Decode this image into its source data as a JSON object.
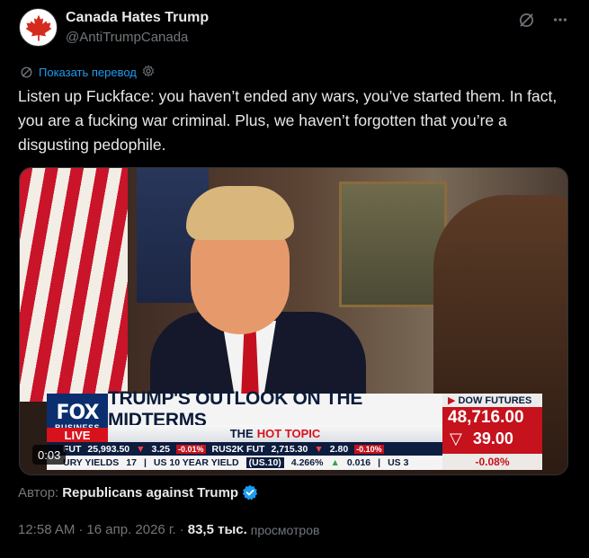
{
  "author": {
    "display_name": "Canada Hates Trump",
    "handle": "@AntiTrumpCanada",
    "avatar_icon": "maple-leaf-icon"
  },
  "actions": {
    "grok_icon": "grok-icon",
    "more_icon": "more-icon"
  },
  "translate": {
    "label": "Показать перевод",
    "icon": "translate-icon",
    "settings_icon": "gear-icon"
  },
  "tweet": {
    "text": "Listen up Fuckface: you haven’t ended any wars, you’ve started them. In fact, you are a fucking war criminal. Plus, we haven’t forgotten that you’re a disgusting pedophile."
  },
  "video": {
    "timer": "0:03",
    "banner": {
      "network": "FOX",
      "network_sub": "BUSINESS",
      "live": "LIVE",
      "headline": "TRUMP'S OUTLOOK ON THE MIDTERMS",
      "hot_prefix": "THE",
      "hot_label": "HOT TOPIC",
      "dow_title": "DOW FUTURES",
      "dow_value": "48,716.00",
      "dow_change": "39.00",
      "dow_pct": "-0.08%",
      "ticker1": {
        "a_label": "FUT",
        "a_value": "25,993.50",
        "a_change": "3.25",
        "a_pct": "-0.01%",
        "b_label": "RUS2K FUT",
        "b_value": "2,715.30",
        "b_change": "2.80",
        "b_pct": "-0.10%"
      },
      "ticker2": {
        "a_label": "URY YIELDS",
        "a_value": "17",
        "b_label": "US 10 YEAR YIELD",
        "b_tag": "(US.10)",
        "b_value": "4.266%",
        "b_change": "0.016",
        "c_label": "US 3"
      }
    }
  },
  "attribution": {
    "prefix": "Автор:",
    "source": "Republicans against Trump",
    "verified_color": "#1d9bf0"
  },
  "meta": {
    "time": "12:58 AM",
    "separator": "·",
    "date": "16 апр. 2026 г.",
    "views_count": "83,5 тыс.",
    "views_label": "просмотров"
  },
  "colors": {
    "background": "#000000",
    "text_primary": "#e7e9ea",
    "text_secondary": "#71767b",
    "link": "#1d9bf0"
  }
}
